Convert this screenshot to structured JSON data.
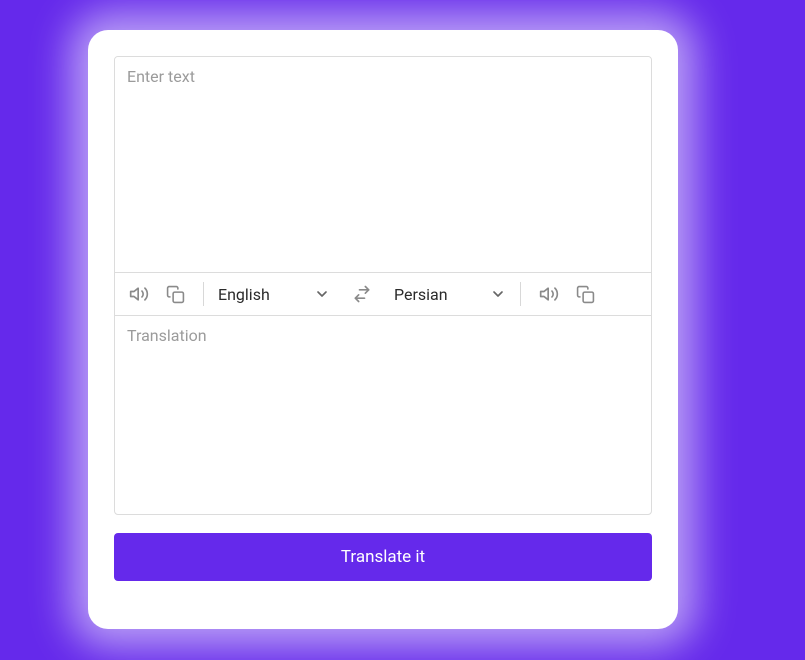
{
  "input": {
    "placeholder": "Enter text",
    "value": ""
  },
  "controls": {
    "source_language": "English",
    "target_language": "Persian"
  },
  "output": {
    "placeholder": "Translation"
  },
  "button": {
    "translate_label": "Translate it"
  },
  "colors": {
    "accent": "#6529eb"
  }
}
